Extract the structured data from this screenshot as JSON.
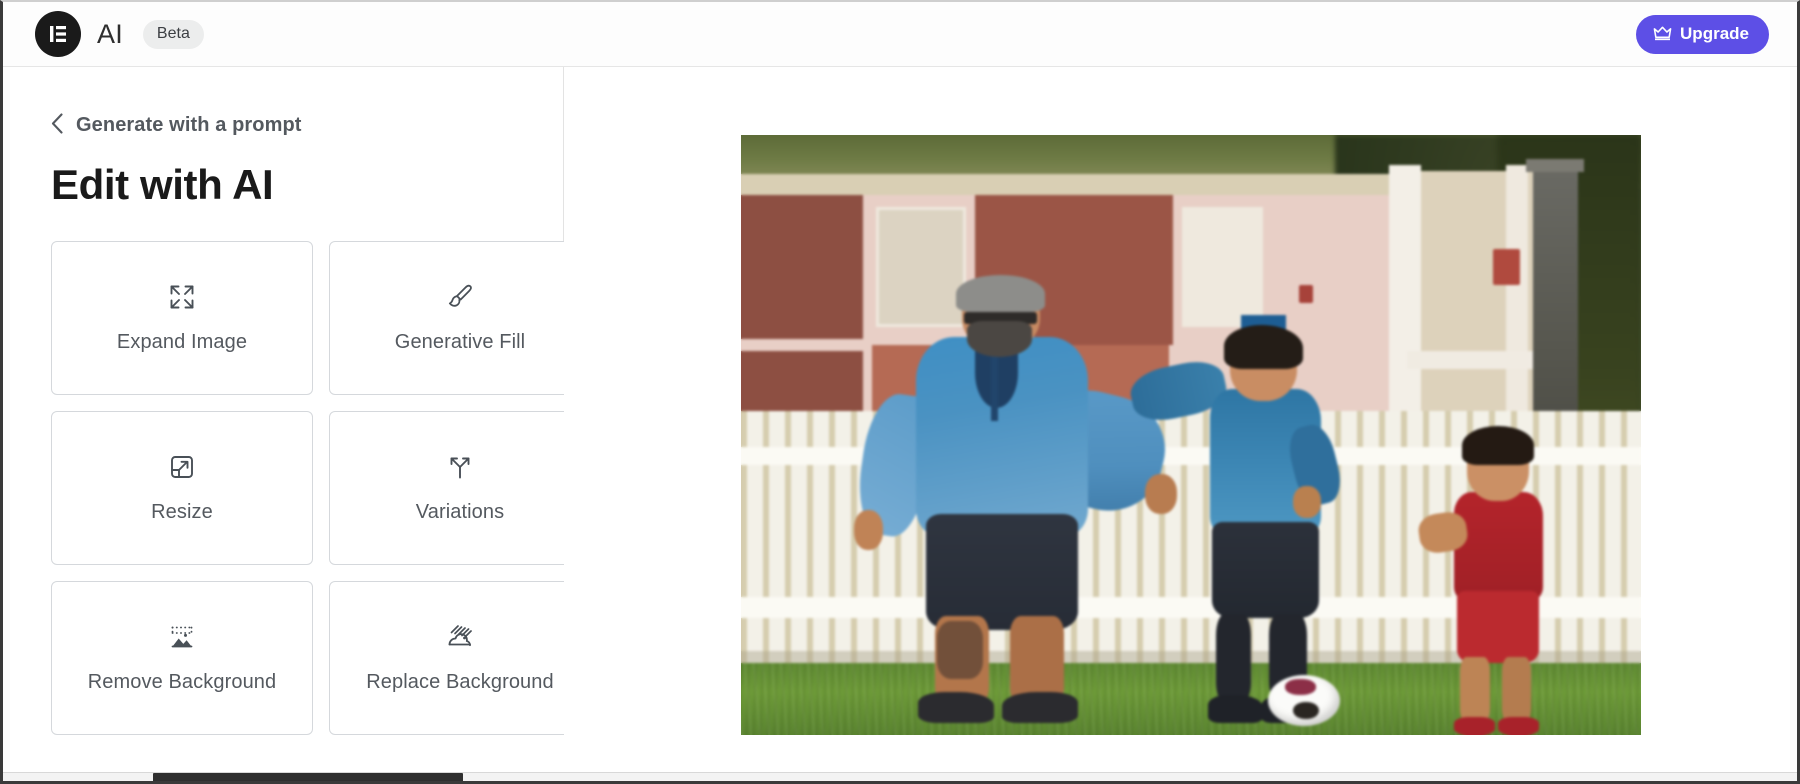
{
  "header": {
    "logo_icon": "elementor-logo-icon",
    "brand_name": "AI",
    "beta_badge": "Beta",
    "upgrade_label": "Upgrade",
    "upgrade_icon": "crown-icon",
    "accent_color": "#5d4fe6"
  },
  "sidebar": {
    "back_icon": "chevron-left-icon",
    "back_label": "Generate with a prompt",
    "title": "Edit with AI",
    "tools": [
      {
        "label": "Expand Image",
        "icon": "expand-arrows-icon"
      },
      {
        "label": "Generative Fill",
        "icon": "paintbrush-icon"
      },
      {
        "label": "Resize",
        "icon": "resize-square-arrow-icon"
      },
      {
        "label": "Variations",
        "icon": "branching-arrows-icon"
      },
      {
        "label": "Remove Background",
        "icon": "image-dotted-border-icon"
      },
      {
        "label": "Replace Background",
        "icon": "image-hatched-icon"
      }
    ]
  },
  "preview": {
    "image_alt": "Man and two boys playing soccer on grass in front of a white picket fence and a house"
  }
}
